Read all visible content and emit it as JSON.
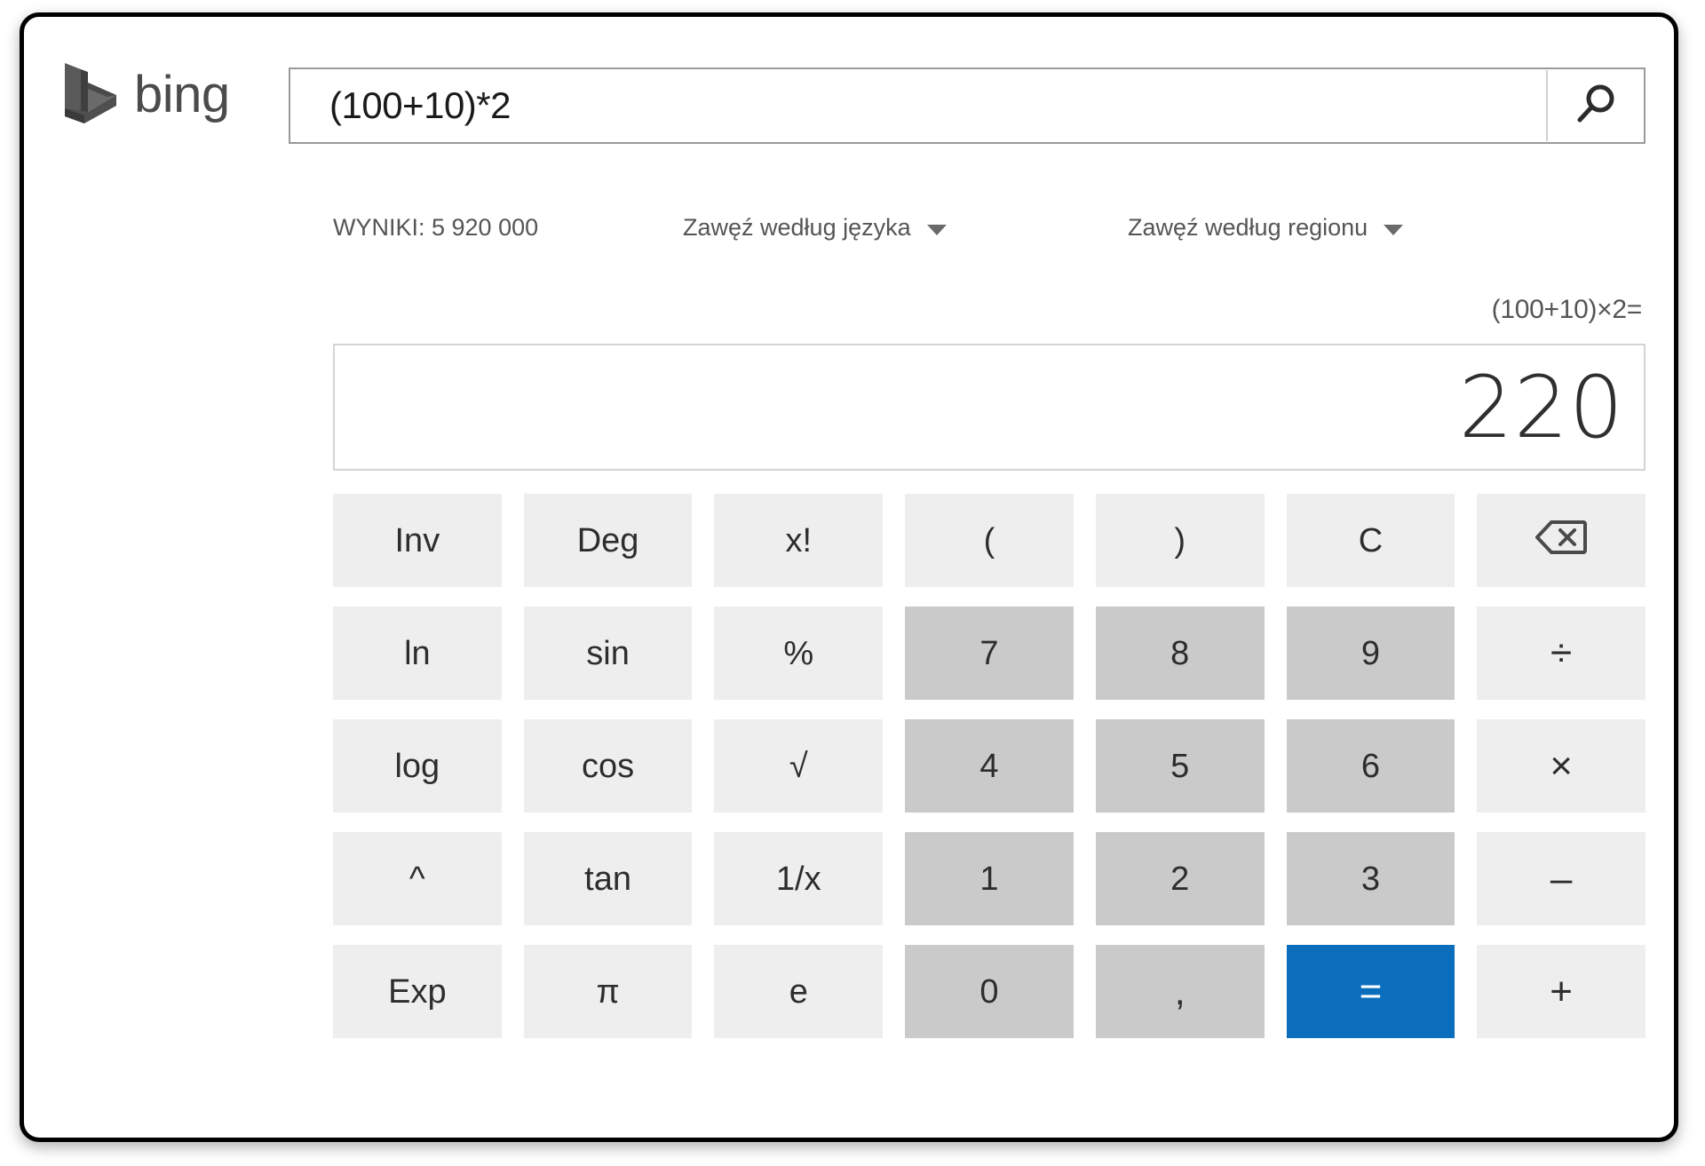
{
  "brand": {
    "name": "bing",
    "logo_icon": "bing-logo-icon"
  },
  "search": {
    "query": "(100+10)*2",
    "placeholder": "",
    "search_icon": "search-icon"
  },
  "filters": {
    "results_count": "WYNIKI: 5 920 000",
    "language": {
      "label": "Zawęź według języka",
      "icon": "chevron-down-icon"
    },
    "region": {
      "label": "Zawęź według regionu",
      "icon": "chevron-down-icon"
    }
  },
  "calculator": {
    "expression": "(100+10)×2=",
    "result": "220",
    "accent_color": "#0a6ebd",
    "number_key_color": "#cacaca",
    "function_key_color": "#eeeeee",
    "rows": [
      [
        {
          "label": "Inv",
          "type": "fn",
          "name": "key-inv"
        },
        {
          "label": "Deg",
          "type": "fn",
          "name": "key-deg"
        },
        {
          "label": "x!",
          "type": "fn",
          "name": "key-factorial"
        },
        {
          "label": "(",
          "type": "fn",
          "name": "key-open-paren"
        },
        {
          "label": ")",
          "type": "fn",
          "name": "key-close-paren"
        },
        {
          "label": "C",
          "type": "fn",
          "name": "key-clear"
        },
        {
          "label": "",
          "type": "icon",
          "icon": "backspace-icon",
          "name": "key-backspace"
        }
      ],
      [
        {
          "label": "ln",
          "type": "fn",
          "name": "key-ln"
        },
        {
          "label": "sin",
          "type": "fn",
          "name": "key-sin"
        },
        {
          "label": "%",
          "type": "fn",
          "name": "key-percent"
        },
        {
          "label": "7",
          "type": "num",
          "name": "key-7"
        },
        {
          "label": "8",
          "type": "num",
          "name": "key-8"
        },
        {
          "label": "9",
          "type": "num",
          "name": "key-9"
        },
        {
          "label": "÷",
          "type": "op",
          "name": "key-divide"
        }
      ],
      [
        {
          "label": "log",
          "type": "fn",
          "name": "key-log"
        },
        {
          "label": "cos",
          "type": "fn",
          "name": "key-cos"
        },
        {
          "label": "√",
          "type": "fn",
          "name": "key-sqrt"
        },
        {
          "label": "4",
          "type": "num",
          "name": "key-4"
        },
        {
          "label": "5",
          "type": "num",
          "name": "key-5"
        },
        {
          "label": "6",
          "type": "num",
          "name": "key-6"
        },
        {
          "label": "×",
          "type": "op",
          "name": "key-multiply"
        }
      ],
      [
        {
          "label": "^",
          "type": "fn",
          "name": "key-power"
        },
        {
          "label": "tan",
          "type": "fn",
          "name": "key-tan"
        },
        {
          "label": "1/x",
          "type": "fn",
          "name": "key-reciprocal"
        },
        {
          "label": "1",
          "type": "num",
          "name": "key-1"
        },
        {
          "label": "2",
          "type": "num",
          "name": "key-2"
        },
        {
          "label": "3",
          "type": "num",
          "name": "key-3"
        },
        {
          "label": "–",
          "type": "op",
          "name": "key-minus"
        }
      ],
      [
        {
          "label": "Exp",
          "type": "fn",
          "name": "key-exp"
        },
        {
          "label": "π",
          "type": "fn",
          "name": "key-pi"
        },
        {
          "label": "e",
          "type": "fn",
          "name": "key-e"
        },
        {
          "label": "0",
          "type": "num",
          "name": "key-0"
        },
        {
          "label": ",",
          "type": "comma",
          "name": "key-decimal-comma"
        },
        {
          "label": "=",
          "type": "equals",
          "name": "key-equals"
        },
        {
          "label": "+",
          "type": "op",
          "name": "key-plus"
        }
      ]
    ]
  }
}
